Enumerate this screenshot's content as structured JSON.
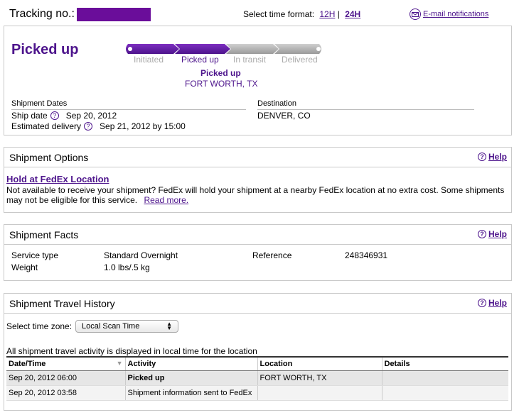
{
  "header": {
    "tracking_label": "Tracking no.:",
    "time_format_label": "Select time format:",
    "fmt_12h": "12H",
    "fmt_24h": "24H",
    "email_label": "E-mail notifications"
  },
  "status": {
    "title": "Picked up",
    "steps": [
      "Initiated",
      "Picked up",
      "In transit",
      "Delivered"
    ],
    "current_step_index": 1,
    "selected_status": "Picked up",
    "selected_location": "FORT WORTH, TX",
    "shipment_dates_label": "Shipment Dates",
    "ship_date_label": "Ship date",
    "ship_date": "Sep 20, 2012",
    "est_delivery_label": "Estimated delivery",
    "est_delivery": "Sep 21, 2012 by 15:00",
    "destination_label": "Destination",
    "destination": "DENVER, CO",
    "accent_color": "#4d148c"
  },
  "options": {
    "title": "Shipment Options",
    "help": "Help",
    "hold_link": "Hold at FedEx Location",
    "hold_desc": "Not available to receive your shipment? FedEx will hold your shipment at a nearby FedEx location at no extra cost. Some shipments may not be eligible for this service.",
    "read_more": "Read more."
  },
  "facts": {
    "title": "Shipment Facts",
    "help": "Help",
    "service_type_label": "Service type",
    "service_type": "Standard Overnight",
    "weight_label": "Weight",
    "weight": "1.0 lbs/.5 kg",
    "reference_label": "Reference",
    "reference": "248346931"
  },
  "history": {
    "title": "Shipment Travel History",
    "help": "Help",
    "tz_label": "Select time zone:",
    "tz_value": "Local Scan Time",
    "note": "All shipment travel activity is displayed in local time for the location",
    "columns": [
      "Date/Time",
      "Activity",
      "Location",
      "Details"
    ],
    "rows": [
      {
        "datetime": "Sep 20, 2012 06:00",
        "activity": "Picked up",
        "location": "FORT WORTH, TX",
        "details": ""
      },
      {
        "datetime": "Sep 20, 2012 03:58",
        "activity": "Shipment information sent to FedEx",
        "location": "",
        "details": ""
      }
    ]
  }
}
